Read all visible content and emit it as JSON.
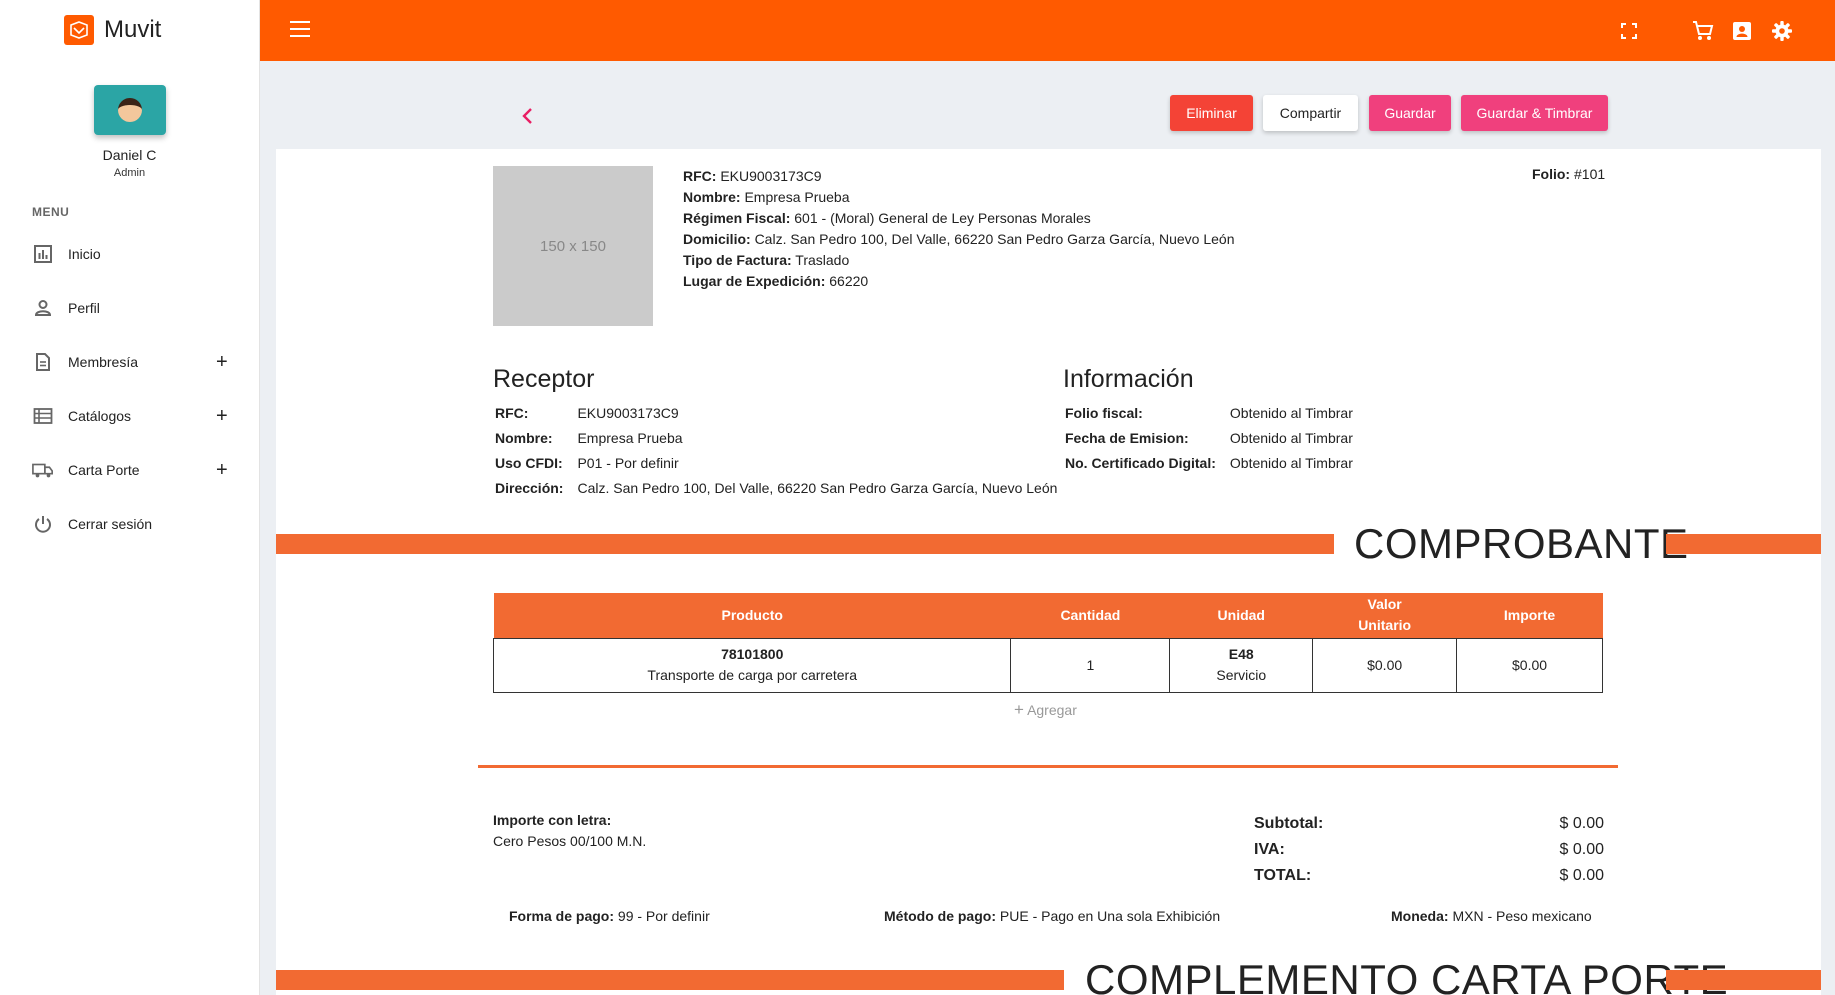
{
  "app": {
    "name": "Muvit",
    "brand_color": "#ff5a00"
  },
  "user": {
    "name": "Daniel C",
    "role": "Admin"
  },
  "menu": {
    "heading": "MENU",
    "items": [
      {
        "label": "Inicio",
        "icon": "bar-chart-icon"
      },
      {
        "label": "Perfil",
        "icon": "person-icon"
      },
      {
        "label": "Membresía",
        "icon": "document-icon",
        "expand": "+"
      },
      {
        "label": "Catálogos",
        "icon": "list-icon",
        "expand": "+"
      },
      {
        "label": "Carta Porte",
        "icon": "truck-icon",
        "expand": "+"
      },
      {
        "label": "Cerrar sesión",
        "icon": "power-icon"
      }
    ]
  },
  "toolbar": {
    "delete": "Eliminar",
    "share": "Compartir",
    "save": "Guardar",
    "save_stamp": "Guardar & Timbrar"
  },
  "logo_placeholder": "150 x 150",
  "emisor": {
    "rfc_label": "RFC:",
    "rfc": "EKU9003173C9",
    "nombre_label": "Nombre:",
    "nombre": "Empresa Prueba",
    "regimen_label": "Régimen Fiscal:",
    "regimen": "601 - (Moral) General de Ley Personas Morales",
    "domicilio_label": "Domicilio:",
    "domicilio": "Calz. San Pedro 100, Del Valle, 66220 San Pedro Garza García, Nuevo León",
    "tipo_label": "Tipo de Factura:",
    "tipo": "Traslado",
    "lugar_label": "Lugar de Expedición:",
    "lugar": "66220"
  },
  "folio": {
    "label": "Folio:",
    "value": "#101"
  },
  "receptor": {
    "title": "Receptor",
    "rfc_label": "RFC:",
    "rfc": "EKU9003173C9",
    "nombre_label": "Nombre:",
    "nombre": "Empresa Prueba",
    "uso_label": "Uso CFDI:",
    "uso": "P01 - Por definir",
    "direccion_label": "Dirección:",
    "direccion": "Calz. San Pedro 100, Del Valle, 66220 San Pedro Garza García, Nuevo León"
  },
  "informacion": {
    "title": "Información",
    "folio_fiscal_label": "Folio fiscal:",
    "folio_fiscal": "Obtenido al Timbrar",
    "fecha_label": "Fecha de Emision:",
    "fecha": "Obtenido al Timbrar",
    "certificado_label": "No. Certificado Digital:",
    "certificado": "Obtenido al Timbrar"
  },
  "comprobante_title": "COMPROBANTE",
  "items_table": {
    "headers": {
      "producto": "Producto",
      "cantidad": "Cantidad",
      "unidad": "Unidad",
      "valor_1": "Valor",
      "valor_2": "Unitario",
      "importe": "Importe"
    },
    "rows": [
      {
        "codigo": "78101800",
        "descripcion": "Transporte de carga por carretera",
        "cantidad": "1",
        "unidad_clave": "E48",
        "unidad_nombre": "Servicio",
        "valor": "$0.00",
        "importe": "$0.00"
      }
    ],
    "add_label": "Agregar"
  },
  "importe_letra": {
    "label": "Importe con letra:",
    "value": "Cero Pesos 00/100 M.N."
  },
  "totals": {
    "subtotal_label": "Subtotal:",
    "subtotal": "$ 0.00",
    "iva_label": "IVA:",
    "iva": "$ 0.00",
    "total_label": "TOTAL:",
    "total": "$ 0.00"
  },
  "pago": {
    "forma_label": "Forma de pago:",
    "forma": "99 - Por definir",
    "metodo_label": "Método de pago:",
    "metodo": "PUE - Pago en Una sola Exhibición",
    "moneda_label": "Moneda:",
    "moneda": "MXN - Peso mexicano"
  },
  "complemento_title": "COMPLEMENTO CARTA PORTE"
}
